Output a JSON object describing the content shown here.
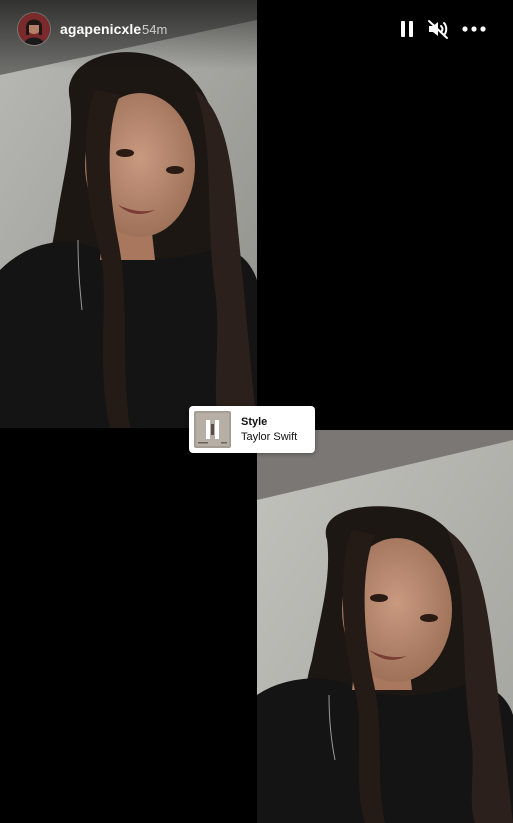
{
  "story": {
    "username": "agapenicxle",
    "time_ago": "54m"
  },
  "controls": {
    "pause_icon": "pause-icon",
    "mute_icon": "speaker-muted-icon",
    "more_icon": "more-horizontal-icon"
  },
  "music_sticker": {
    "title": "Style",
    "artist": "Taylor Swift"
  },
  "colors": {
    "background": "#000000",
    "sticker_background": "#ffffff",
    "text_primary": "#ffffff"
  }
}
